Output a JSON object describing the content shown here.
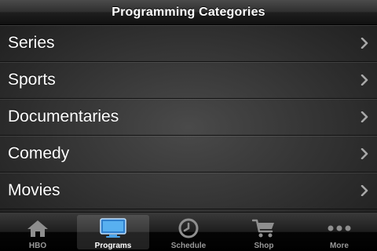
{
  "navbar": {
    "title": "Programming Categories"
  },
  "list": {
    "items": [
      {
        "label": "Series"
      },
      {
        "label": "Sports"
      },
      {
        "label": "Documentaries"
      },
      {
        "label": "Comedy"
      },
      {
        "label": "Movies"
      }
    ],
    "chevron_icon": "chevron-right-icon"
  },
  "tabbar": {
    "selected": "Programs",
    "tabs": [
      {
        "label": "HBO",
        "icon": "home-icon"
      },
      {
        "label": "Programs",
        "icon": "tv-icon"
      },
      {
        "label": "Schedule",
        "icon": "clock-icon"
      },
      {
        "label": "Shop",
        "icon": "cart-icon"
      },
      {
        "label": "More",
        "icon": "more-dots-icon"
      }
    ]
  },
  "colors": {
    "selected_tab_icon": "#4aa3e8",
    "inactive_tab_icon": "#8e8e8e",
    "row_text": "#ffffff"
  }
}
